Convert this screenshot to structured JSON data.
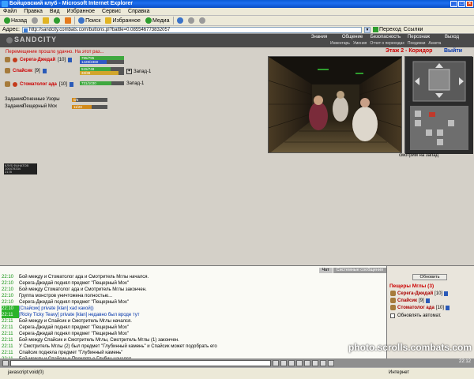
{
  "window": {
    "title": "Бойцовский клуб - Microsoft Internet Explorer"
  },
  "menu": [
    "Файл",
    "Правка",
    "Вид",
    "Избранное",
    "Сервис",
    "Справка"
  ],
  "toolbar": {
    "back": "Назад",
    "search": "Поиск",
    "favorites": "Избранное",
    "media": "Медиа"
  },
  "address": {
    "label": "Адрес:",
    "url": "http://sandcity.combats.com/buttons.pl?battle=0.085546773832057",
    "go": "Переход",
    "links": "Ссылки"
  },
  "game": {
    "logo": "SANDCITY",
    "menu": [
      "Знания",
      "Общение",
      "Безопасность",
      "Персонаж",
      "Выход"
    ],
    "submenu": [
      "Инвентарь",
      "Умения",
      "Отчет о переходах",
      "Поединки",
      "Анкета"
    ]
  },
  "main": {
    "message": "Перемещение прошло удачно. На этот раз...",
    "zone": "Этаж 2 - Коридор",
    "exit": "Выйти",
    "looking": "смотрим на запад"
  },
  "party": [
    {
      "name": "Серега-Джедай",
      "level": "[10]",
      "hp": "795/795",
      "mp": "1428/2360",
      "hp_frac": 1.0,
      "mp_frac": 0.6
    },
    {
      "name": "Спайсик",
      "level": "[9]",
      "hp": "515/748",
      "mp": "33/38",
      "hp_frac": 0.69,
      "mp_frac": 0.87
    },
    {
      "name": "Стоматолог ада",
      "level": "[10]",
      "hp": "731/1030",
      "hp_frac": 0.71
    }
  ],
  "directions": [
    {
      "label": "Запад-1"
    },
    {
      "label": "Запад-1"
    }
  ],
  "tasks": [
    {
      "label": "Задание:",
      "name": "Огненные Узоры",
      "value": "0/5",
      "frac": 0.1
    },
    {
      "label": "Задание:",
      "name": "Пещерный Мох",
      "value": "11/20",
      "frac": 0.55
    }
  ],
  "counter": [
    "КЛУБ ФАНАТОВ",
    "100478334",
    "2178"
  ],
  "chat": {
    "tabs": [
      "Чат",
      "Системные сообщения"
    ],
    "lines": [
      {
        "time": "22:10",
        "text": "Бой между и Стоматолог ада и Смотритель Мглы начался."
      },
      {
        "time": "22:10",
        "text": "Серега-Джедай поднял предмет \"Пещерный Мох\""
      },
      {
        "time": "22:10",
        "text": "Бой между Стоматолог ада и Смотритель Мглы закончен."
      },
      {
        "time": "22:10",
        "text": "Группа монстров уничтожена полностью..."
      },
      {
        "time": "22:10",
        "text": "Серега-Джедай поднял предмет \"Пещерный Мох\""
      },
      {
        "time": "22:10",
        "text": "[Спайсик] private [klan] хаd какой))",
        "hl": true
      },
      {
        "time": "22:11",
        "text": "[Ricky Ticky Teavy] private [klan] недавно был вроде тут",
        "hl": true
      },
      {
        "time": "22:11",
        "text": "Бой между и Спайсик и Смотритель Мглы начался."
      },
      {
        "time": "22:11",
        "text": "Серега-Джедай поднял предмет \"Пещерный Мох\""
      },
      {
        "time": "22:11",
        "text": "Серега-Джедай поднял предмет \"Пещерный Мох\""
      },
      {
        "time": "22:11",
        "text": "Бой между Спайсик и Смотритель Мглы, Смотритель Мглы (1) закончен."
      },
      {
        "time": "22:11",
        "text": "У Смотритель Мглы (2) был предмет \"Глубинный камень\" и Спайсик может подобрать его"
      },
      {
        "time": "22:11",
        "text": "Спайсик подняла предмет \"Глубинный камень\""
      },
      {
        "time": "22:11",
        "text": "Бой между и Спайсик и Проклятье Глубин начался."
      }
    ]
  },
  "roster": {
    "refresh": "Обновить",
    "title": "Пещеры Мглы (3)",
    "members": [
      {
        "name": "Серега-Джедай",
        "level": "[10]"
      },
      {
        "name": "Спайсик",
        "level": "[9]"
      },
      {
        "name": "Стоматолог ада",
        "level": "[10]"
      }
    ],
    "auto": "Обновлять автомат."
  },
  "inputbar": {
    "clock": "22:12"
  },
  "status": {
    "text": "javascript:void(0)",
    "zone": "Интернет"
  },
  "watermark": "photo.scrolls.combats.com"
}
